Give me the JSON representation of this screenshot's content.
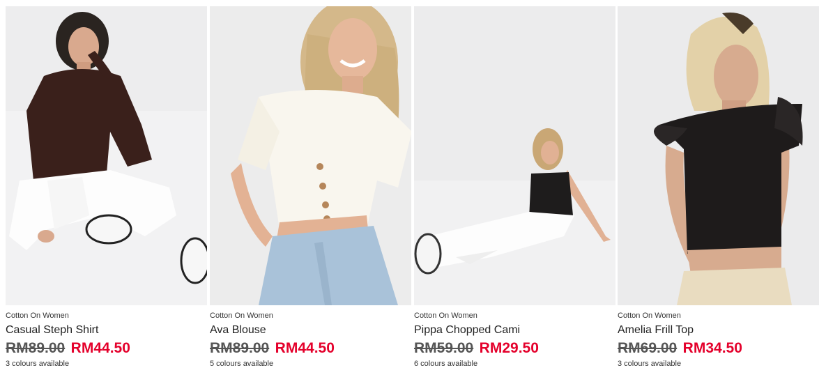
{
  "colors": {
    "sale_price": "#e4002b",
    "original_price": "#555555",
    "photo_background": "#ededee"
  },
  "products": [
    {
      "brand": "Cotton On Women",
      "name": "Casual Steph Shirt",
      "original_price": "RM89.00",
      "sale_price": "RM44.50",
      "colours": "3 colours available"
    },
    {
      "brand": "Cotton On Women",
      "name": "Ava Blouse",
      "original_price": "RM89.00",
      "sale_price": "RM44.50",
      "colours": "5 colours available"
    },
    {
      "brand": "Cotton On Women",
      "name": "Pippa Chopped Cami",
      "original_price": "RM59.00",
      "sale_price": "RM29.50",
      "colours": "6 colours available"
    },
    {
      "brand": "Cotton On Women",
      "name": "Amelia Frill Top",
      "original_price": "RM69.00",
      "sale_price": "RM34.50",
      "colours": "3 colours available"
    }
  ]
}
